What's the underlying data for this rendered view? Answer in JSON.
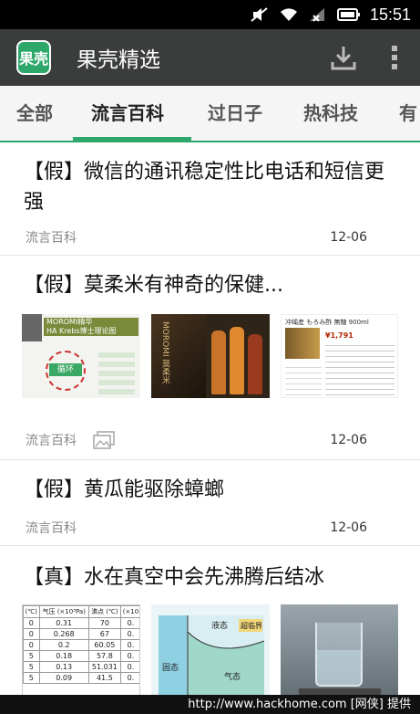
{
  "status_bar": {
    "time": "15:51",
    "icons": [
      "mute-icon",
      "wifi-icon",
      "signal-icon",
      "battery-icon"
    ]
  },
  "app": {
    "logo_text": "果壳",
    "title": "果壳精选"
  },
  "tabs": [
    {
      "label": "全部",
      "active": false
    },
    {
      "label": "流言百科",
      "active": true
    },
    {
      "label": "过日子",
      "active": false
    },
    {
      "label": "热科技",
      "active": false
    },
    {
      "label": "有",
      "active": false
    }
  ],
  "accent_color": "#2ea76a",
  "articles": [
    {
      "title": "【假】微信的通讯稳定性比电话和短信更强",
      "category": "流言百科",
      "date": "12-06"
    },
    {
      "title": "【假】莫柔米有神奇的保健...",
      "category": "流言百科",
      "date": "12-06",
      "thumb1": {
        "banner": "MOROMI精华",
        "sub": "HA Krebs博士理论图",
        "center": "循环"
      },
      "thumb2": {
        "text": "MOROMI 莫柔米"
      },
      "thumb3": {
        "title": "冲绳産 もろみ酢 無糖 900ml",
        "price": "¥1,791"
      }
    },
    {
      "title": "【假】黄瓜能驱除蟑螂",
      "category": "流言百科",
      "date": "12-06"
    },
    {
      "title": "【真】水在真空中会先沸腾后结冰",
      "table": {
        "headers": [
          "(℃)",
          "气压 (×10³Pa)",
          "沸点 (℃)",
          "(×10"
        ],
        "rows": [
          [
            "0",
            "0.31",
            "70",
            "0."
          ],
          [
            "0",
            "0.268",
            "67",
            "0."
          ],
          [
            "0",
            "0.2",
            "60.05",
            "0."
          ],
          [
            "5",
            "0.18",
            "57.8",
            "0."
          ],
          [
            "5",
            "0.13",
            "51.031",
            "0."
          ],
          [
            "5",
            "0.09",
            "41.5",
            "0."
          ]
        ]
      },
      "diagram": {
        "region_liquid": "液态",
        "region_solid": "固态",
        "region_gas": "气态",
        "region_super": "超临界"
      }
    }
  ],
  "watermark": "http://www.hackhome.com [网侠] 提供"
}
